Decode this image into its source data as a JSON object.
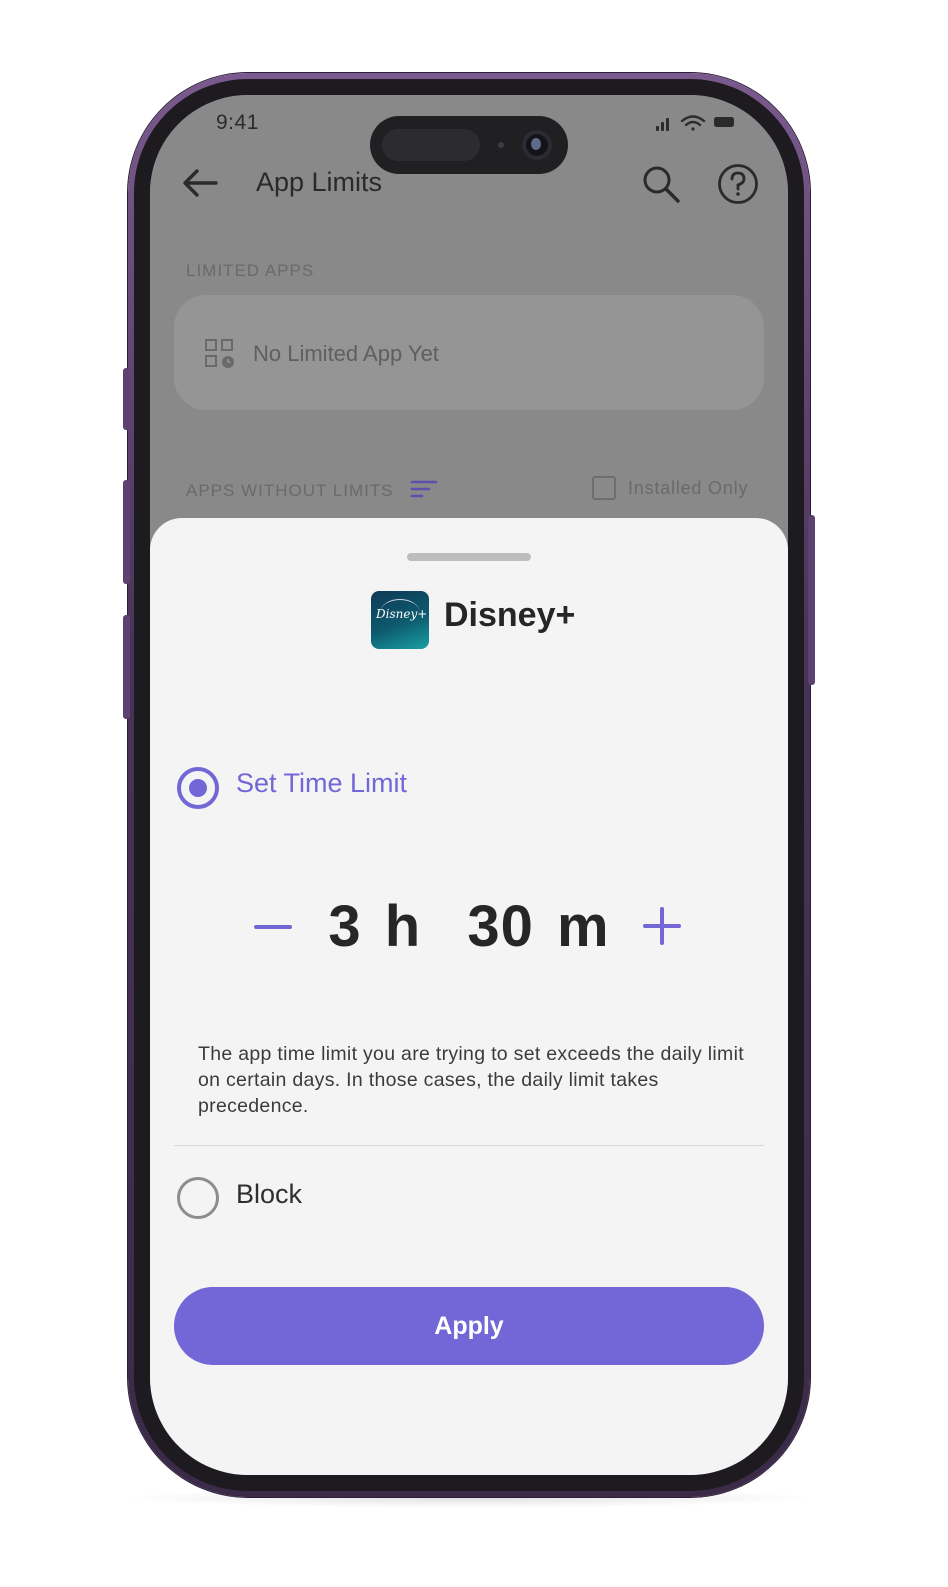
{
  "status_bar": {
    "time": "9:41"
  },
  "app_bar": {
    "title": "App Limits"
  },
  "limited_apps": {
    "section_label": "LIMITED APPS",
    "empty_text": "No Limited App Yet"
  },
  "apps_without_limits": {
    "section_label": "APPS WITHOUT LIMITS",
    "installed_only_label": "Installed Only",
    "installed_only_checked": false
  },
  "sheet": {
    "app_name": "Disney+",
    "app_icon_text": "Disney+",
    "options": [
      {
        "label": "Set Time Limit",
        "selected": true
      },
      {
        "label": "Block",
        "selected": false
      }
    ],
    "time_limit": {
      "display": "3 h  30 m",
      "hours": 3,
      "minutes": 30
    },
    "warning_text": "The app time limit you are trying to set exceeds the daily limit on certain days. In those cases, the daily limit takes precedence.",
    "apply_label": "Apply"
  },
  "colors": {
    "accent": "#7366d6",
    "sheet_background": "#f4f4f5",
    "phone_frame": "#5b4270"
  }
}
